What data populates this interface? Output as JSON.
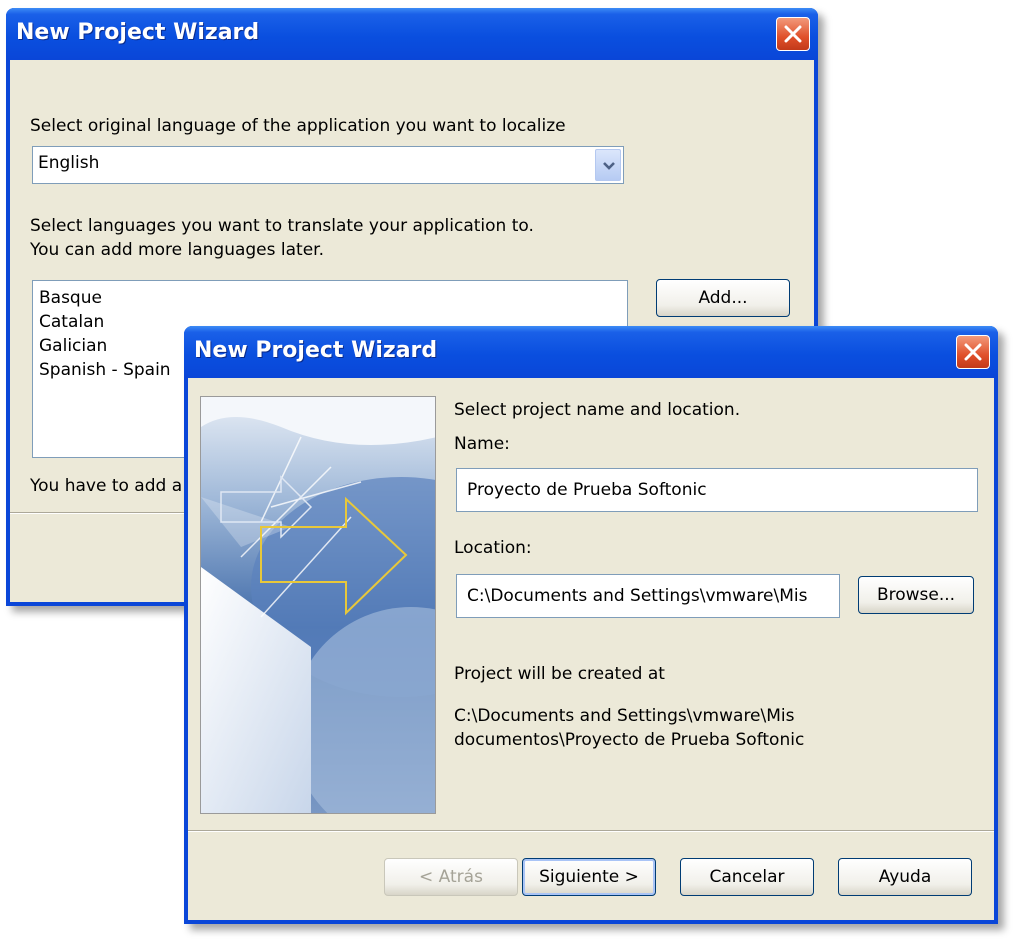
{
  "back_window": {
    "title": "New Project Wizard",
    "original_language_label": "Select original language of the application you want to localize",
    "original_language_value": "English",
    "target_languages_label_line1": "Select languages you want to translate your application to.",
    "target_languages_label_line2": "You can add more languages later.",
    "languages": [
      "Basque",
      "Catalan",
      "Galician",
      "Spanish - Spain"
    ],
    "add_button": "Add...",
    "note_text": "You have to add a"
  },
  "front_window": {
    "title": "New Project Wizard",
    "instruction": "Select project name and location.",
    "name_label": "Name:",
    "name_value": "Proyecto de Prueba Softonic",
    "location_label": "Location:",
    "location_value": "C:\\Documents and Settings\\vmware\\Mis",
    "browse_button": "Browse...",
    "created_at_label": "Project will be created at",
    "created_path_line1": "C:\\Documents and Settings\\vmware\\Mis",
    "created_path_line2": "documentos\\Proyecto de Prueba Softonic",
    "buttons": {
      "back": "< Atrás",
      "next": "Siguiente >",
      "cancel": "Cancelar",
      "help": "Ayuda"
    }
  },
  "icons": {
    "close": "close-icon",
    "dropdown": "chevron-down-icon"
  },
  "colors": {
    "title_bar": "#0a46d8",
    "client_bg": "#ece9d8",
    "close_button": "#e0502a",
    "wizard_arrow": "#e8c83a"
  }
}
